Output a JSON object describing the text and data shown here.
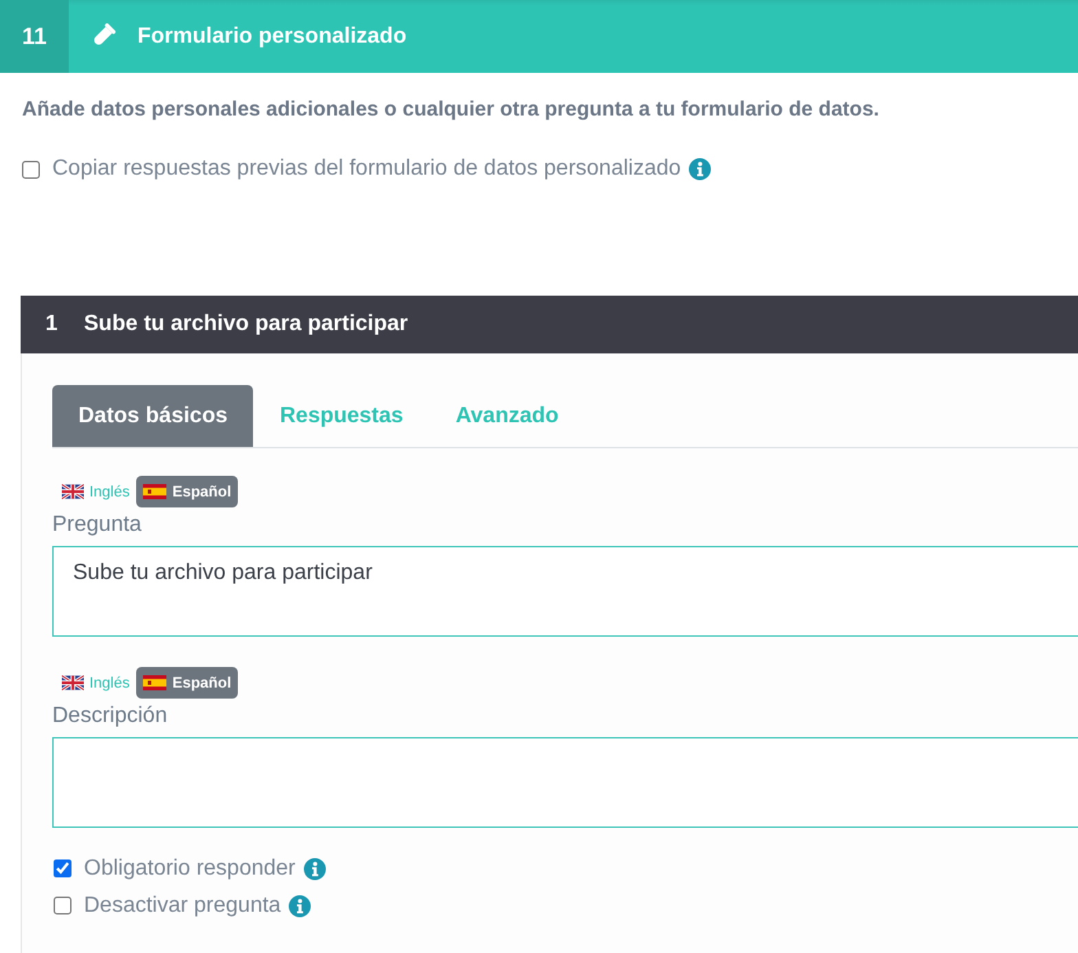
{
  "step": {
    "number": "11",
    "title": "Formulario personalizado"
  },
  "intro": "Añade datos personales adicionales o cualquier otra pregunta a tu formulario de datos.",
  "copy_option": {
    "label": "Copiar respuestas previas del formulario de datos personalizado",
    "checked": false
  },
  "question": {
    "number": "1",
    "title": "Sube tu archivo para participar",
    "tabs": [
      {
        "label": "Datos básicos",
        "selected": true
      },
      {
        "label": "Respuestas",
        "selected": false
      },
      {
        "label": "Avanzado",
        "selected": false
      }
    ],
    "fields": [
      {
        "languages": [
          {
            "label": "Inglés",
            "kind": "uk",
            "selected": false
          },
          {
            "label": "Español",
            "kind": "es",
            "selected": true
          }
        ],
        "label": "Pregunta",
        "value": "Sube tu archivo para participar"
      },
      {
        "languages": [
          {
            "label": "Inglés",
            "kind": "uk",
            "selected": false
          },
          {
            "label": "Español",
            "kind": "es",
            "selected": true
          }
        ],
        "label": "Descripción"
      }
    ],
    "options": [
      {
        "label": "Obligatorio responder",
        "checked": true
      },
      {
        "label": "Desactivar pregunta",
        "checked": false
      }
    ]
  }
}
